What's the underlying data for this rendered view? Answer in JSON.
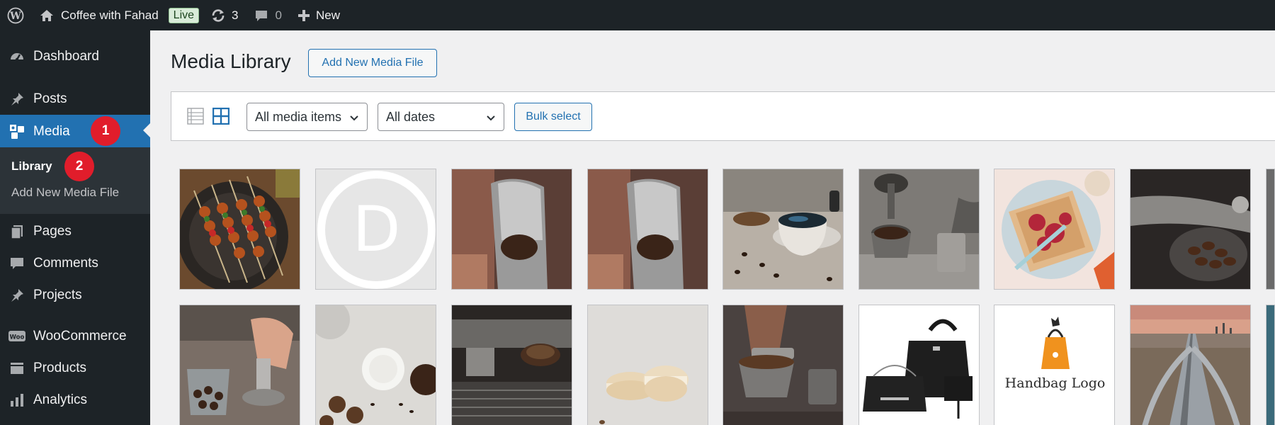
{
  "adminbar": {
    "site_name": "Coffee with Fahad",
    "live_badge": "Live",
    "updates_count": "3",
    "comments_count": "0",
    "new_label": "New"
  },
  "sidebar": {
    "dashboard": "Dashboard",
    "posts": "Posts",
    "media": "Media",
    "library": "Library",
    "add_new_media": "Add New Media File",
    "pages": "Pages",
    "comments": "Comments",
    "projects": "Projects",
    "woocommerce": "WooCommerce",
    "woo_icon_text": "Woo",
    "products": "Products",
    "analytics": "Analytics",
    "step1": "1",
    "step2": "2"
  },
  "main": {
    "title": "Media Library",
    "add_new_button": "Add New Media File",
    "filter_type": "All media items",
    "filter_date": "All dates",
    "bulk_select": "Bulk select"
  },
  "media_items": [
    {
      "subject": "grilled kebab skewers"
    },
    {
      "subject": "Divi logo placeholder",
      "logo_letter": "D"
    },
    {
      "subject": "coffee bean pouch"
    },
    {
      "subject": "coffee bean pouch"
    },
    {
      "subject": "espresso cup with beans"
    },
    {
      "subject": "espresso portafilter"
    },
    {
      "subject": "toast with jam"
    },
    {
      "subject": "coffee grinder"
    },
    {
      "subject": "coffee tamping"
    },
    {
      "subject": "cups and cookies top view"
    },
    {
      "subject": "espresso machine"
    },
    {
      "subject": "macarons"
    },
    {
      "subject": "barista with portafilter"
    },
    {
      "subject": "black handbag set"
    },
    {
      "subject": "handbag logo",
      "logo_text": "Handbag Logo"
    },
    {
      "subject": "highway aerial at sunset"
    }
  ],
  "colors": {
    "admin_dark": "#1d2327",
    "accent_blue": "#2271b1",
    "badge_red": "#e11d2b"
  }
}
